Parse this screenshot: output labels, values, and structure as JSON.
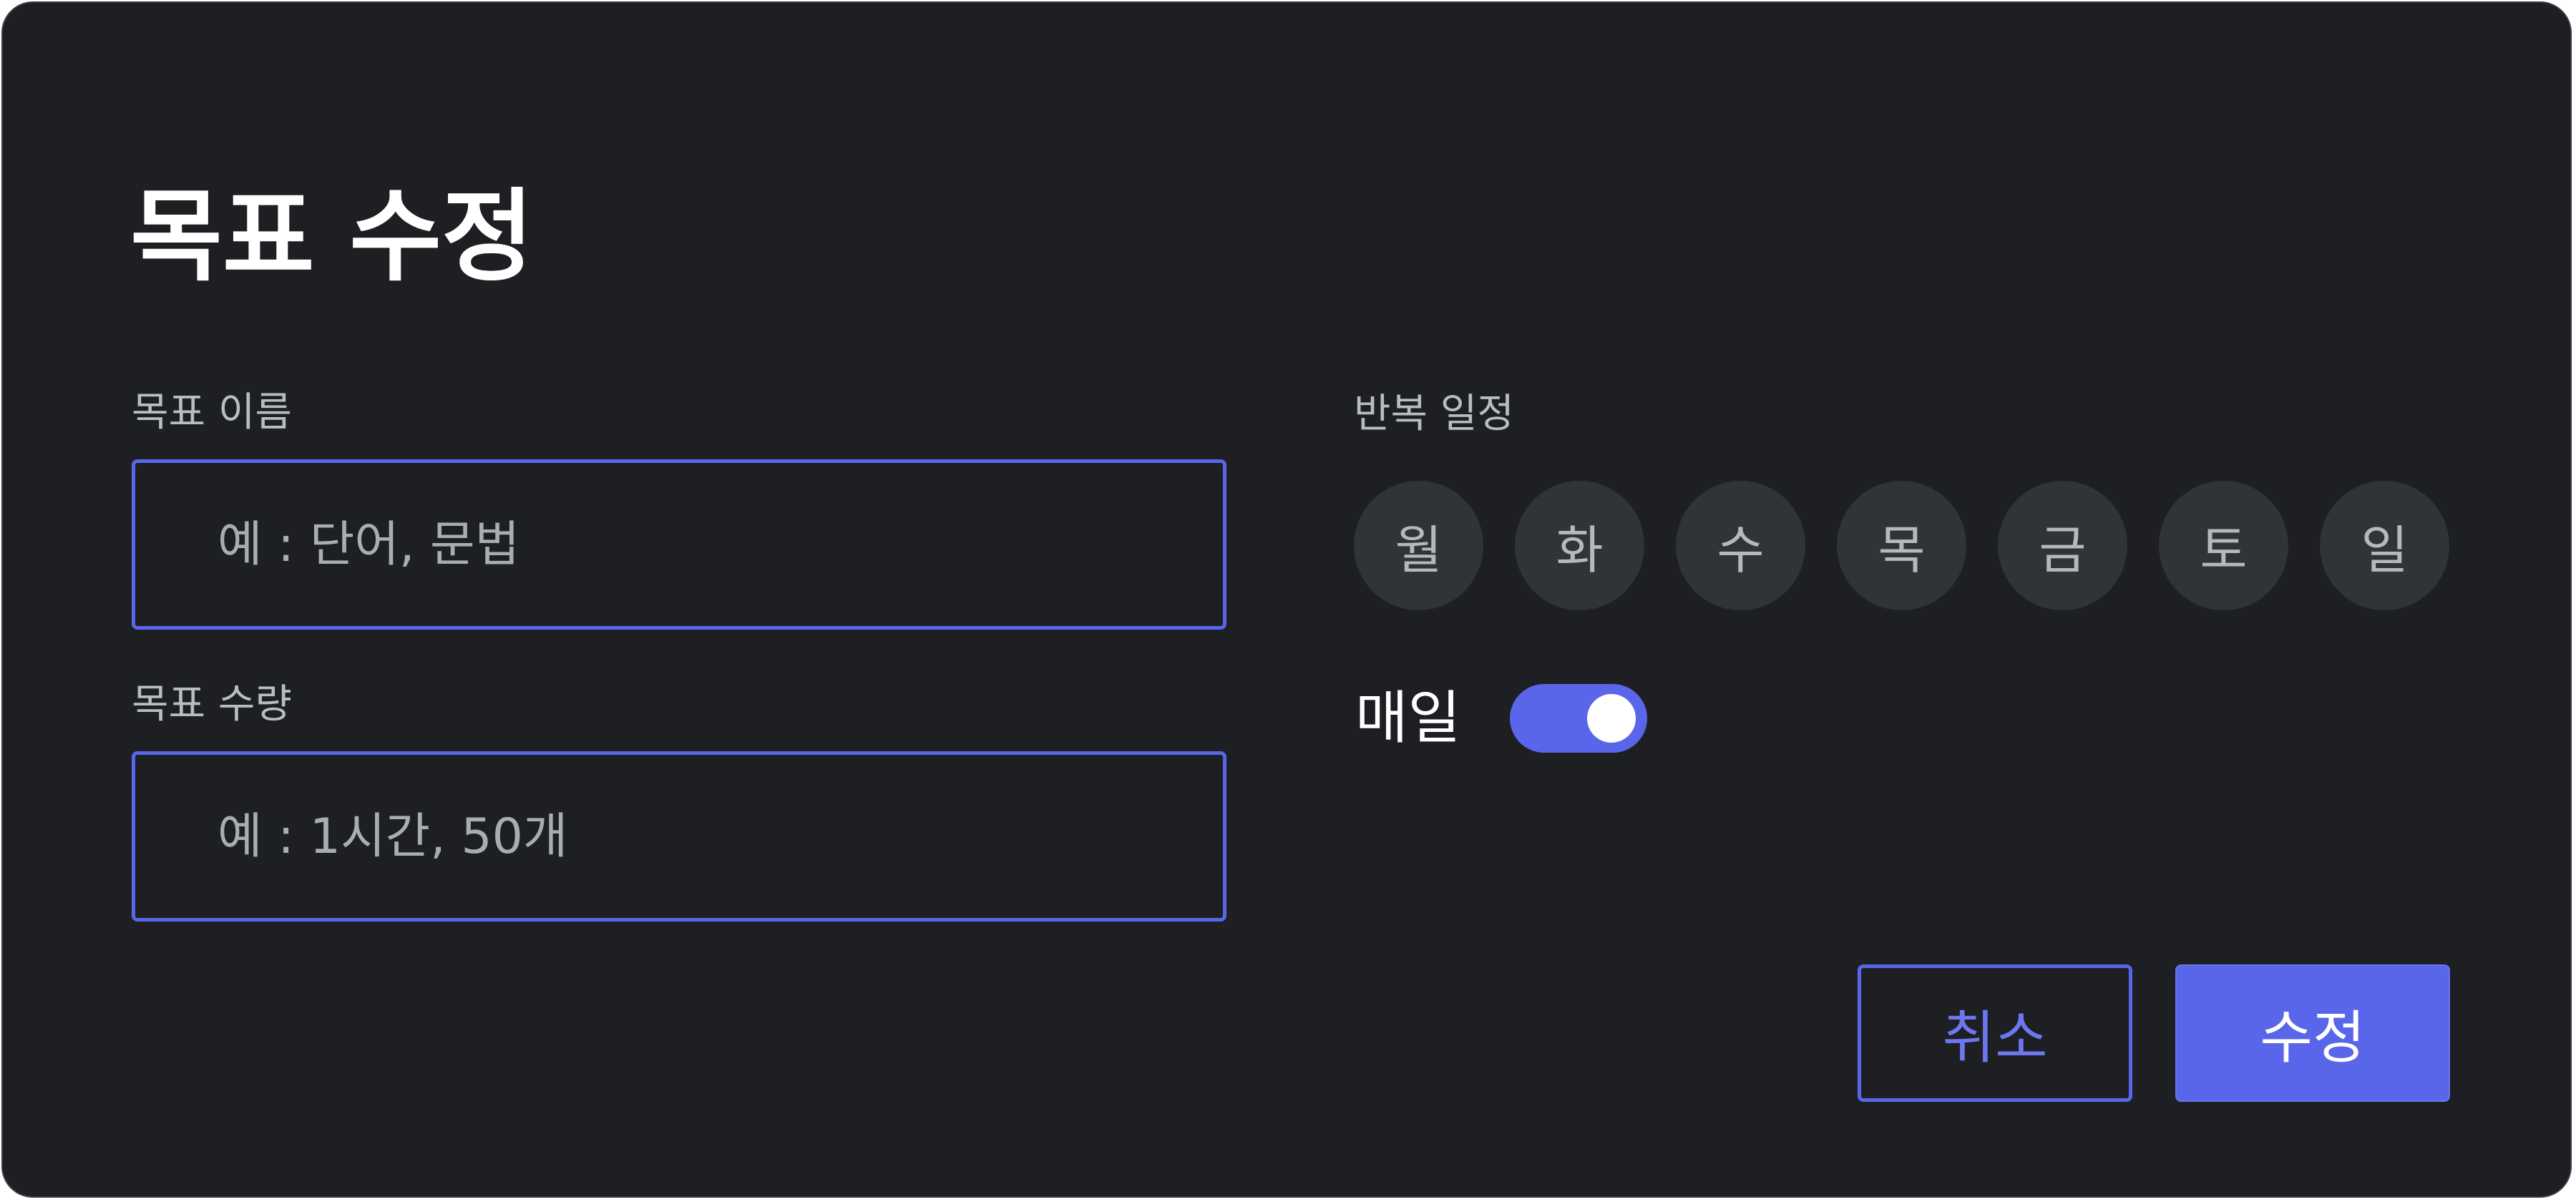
{
  "dialog": {
    "title": "목표 수정"
  },
  "goal_name": {
    "label": "목표 이름",
    "value": "",
    "placeholder": "예 : 단어, 문법"
  },
  "goal_amount": {
    "label": "목표 수량",
    "value": "",
    "placeholder": "예 : 1시간, 50개"
  },
  "schedule": {
    "label": "반복 일정",
    "days": [
      "월",
      "화",
      "수",
      "목",
      "금",
      "토",
      "일"
    ],
    "daily_label": "매일",
    "daily_enabled": true
  },
  "actions": {
    "cancel_label": "취소",
    "submit_label": "수정"
  },
  "colors": {
    "background": "#1d1f22",
    "accent": "#5a66ea",
    "day_chip": "#303338",
    "text": "#ffffff",
    "muted_text": "#b9bcc2"
  }
}
